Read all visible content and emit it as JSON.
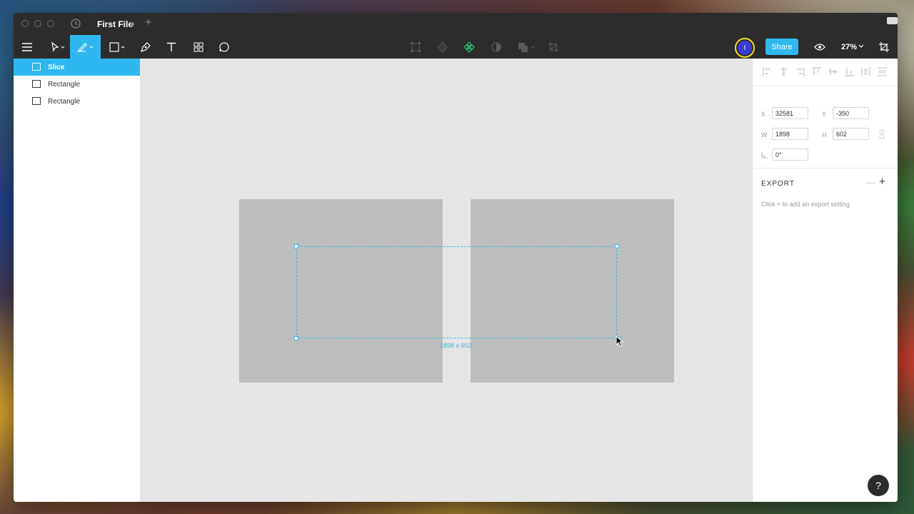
{
  "titlebar": {
    "file_title": "First File",
    "new_tab": "+"
  },
  "toolbar": {
    "share_label": "Share",
    "zoom": "27%",
    "avatar_initial": "I",
    "avatar_color": "#3b3bd4",
    "accent": "#2fb8ef"
  },
  "layers": {
    "items": [
      {
        "name": "Slice",
        "icon": "slice-icon",
        "selected": true
      },
      {
        "name": "Rectangle",
        "icon": "rectangle-icon",
        "selected": false
      },
      {
        "name": "Rectangle",
        "icon": "rectangle-icon",
        "selected": false
      }
    ]
  },
  "canvas": {
    "slice_dimensions": "1898 x 602"
  },
  "properties": {
    "x_label": "X",
    "x_value": "32581",
    "y_label": "Y",
    "y_value": "-350",
    "w_label": "W",
    "w_value": "1898",
    "h_label": "H",
    "h_value": "602",
    "rotation_value": "0°",
    "export_title": "EXPORT",
    "export_minus": "—",
    "export_plus": "+",
    "export_hint": "Click + to add an export setting"
  },
  "help": {
    "label": "?"
  }
}
